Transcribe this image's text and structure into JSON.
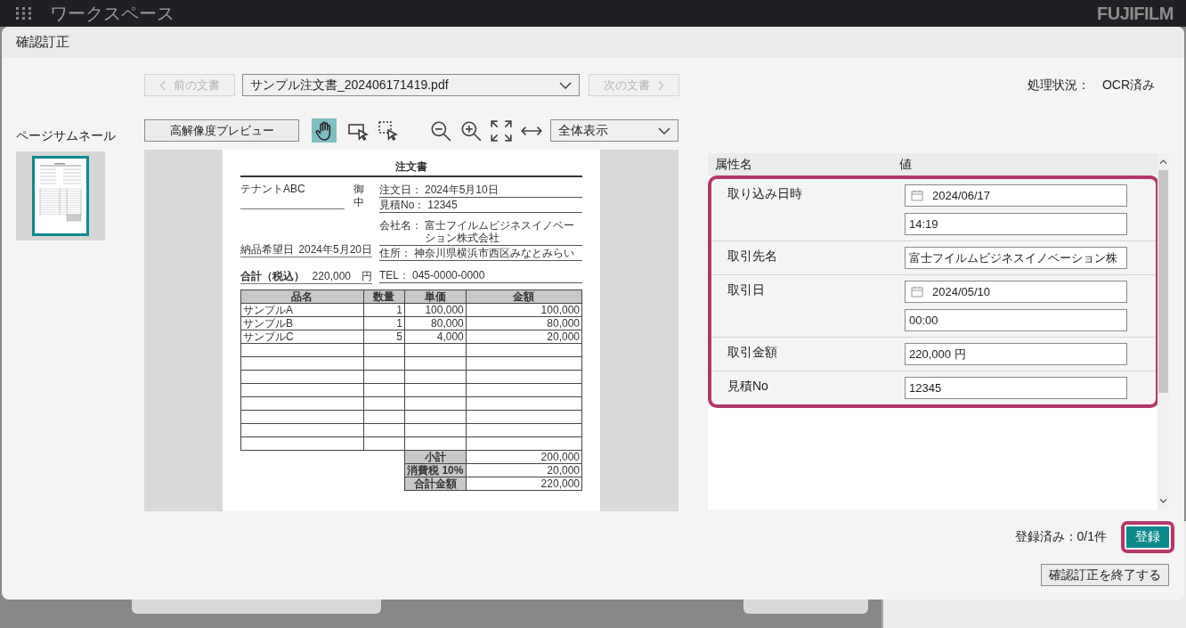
{
  "app_bar": {
    "title": "ワークスペース",
    "logo": "FUJIFILM"
  },
  "dialog": {
    "title": "確認訂正"
  },
  "nav": {
    "prev": {
      "label": "前の文書",
      "disabled": true
    },
    "file_select": {
      "value": "サンプル注文書_202406171419.pdf"
    },
    "next": {
      "label": "次の文書",
      "disabled": true
    },
    "status_label": "処理状況：",
    "status_value": "OCR済み"
  },
  "thumbnails": {
    "title": "ページサムネール",
    "pages": [
      {
        "selected": true
      }
    ]
  },
  "toolbar": {
    "preview_button": "高解像度プレビュー",
    "tools": [
      {
        "kind": "hand",
        "selected": true
      },
      {
        "kind": "pointer-select",
        "selected": false
      },
      {
        "kind": "area-select",
        "selected": false
      }
    ],
    "zoom_select": {
      "value": "全体表示"
    }
  },
  "document": {
    "title": "注文書",
    "recipient": "テナントABC",
    "honorific": "御中",
    "delivery_label": "納品希望日",
    "delivery_value": "2024年5月20日",
    "total_label": "合計（税込）",
    "total_value": "220,000",
    "total_unit": "円",
    "fields": [
      {
        "label": "注文日：",
        "value": "2024年5月10日"
      },
      {
        "label": "見積No：",
        "value": "12345"
      },
      {
        "label": "会社名：",
        "value": "富士フイルムビジネスイノベーション株式会社"
      },
      {
        "label": "住所：",
        "value": "神奈川県横浜市西区みなとみらい"
      },
      {
        "label": "TEL：",
        "value": "045-0000-0000"
      }
    ],
    "table": {
      "columns": [
        "品名",
        "数量",
        "単価",
        "金額"
      ],
      "rows": [
        [
          "サンプルA",
          "1",
          "100,000",
          "100,000"
        ],
        [
          "サンプルB",
          "1",
          "80,000",
          "80,000"
        ],
        [
          "サンプルC",
          "5",
          "4,000",
          "20,000"
        ]
      ]
    },
    "summary": [
      {
        "label": "小計",
        "value": "200,000"
      },
      {
        "label": "消費税 10%",
        "value": "20,000"
      },
      {
        "label": "合計金額",
        "value": "220,000"
      }
    ]
  },
  "attributes": {
    "name_header": "属性名",
    "value_header": "値",
    "rows": [
      {
        "label": "取り込み日時",
        "fields": [
          {
            "kind": "date",
            "value": "2024/06/17"
          },
          {
            "kind": "time",
            "value": "14:19"
          }
        ]
      },
      {
        "label": "取引先名",
        "fields": [
          {
            "kind": "text",
            "value": "富士フイルムビジネスイノベーション株"
          }
        ]
      },
      {
        "label": "取引日",
        "fields": [
          {
            "kind": "date",
            "value": "2024/05/10"
          },
          {
            "kind": "time",
            "value": "00:00"
          }
        ]
      },
      {
        "label": "取引金額",
        "fields": [
          {
            "kind": "text",
            "value": "220,000 円"
          }
        ]
      },
      {
        "label": "見積No",
        "fields": [
          {
            "kind": "text",
            "value": "12345"
          }
        ]
      }
    ]
  },
  "footer": {
    "registered": "登録済み：0/1件",
    "register_button": "登録",
    "finish_button": "確認訂正を終了する"
  }
}
